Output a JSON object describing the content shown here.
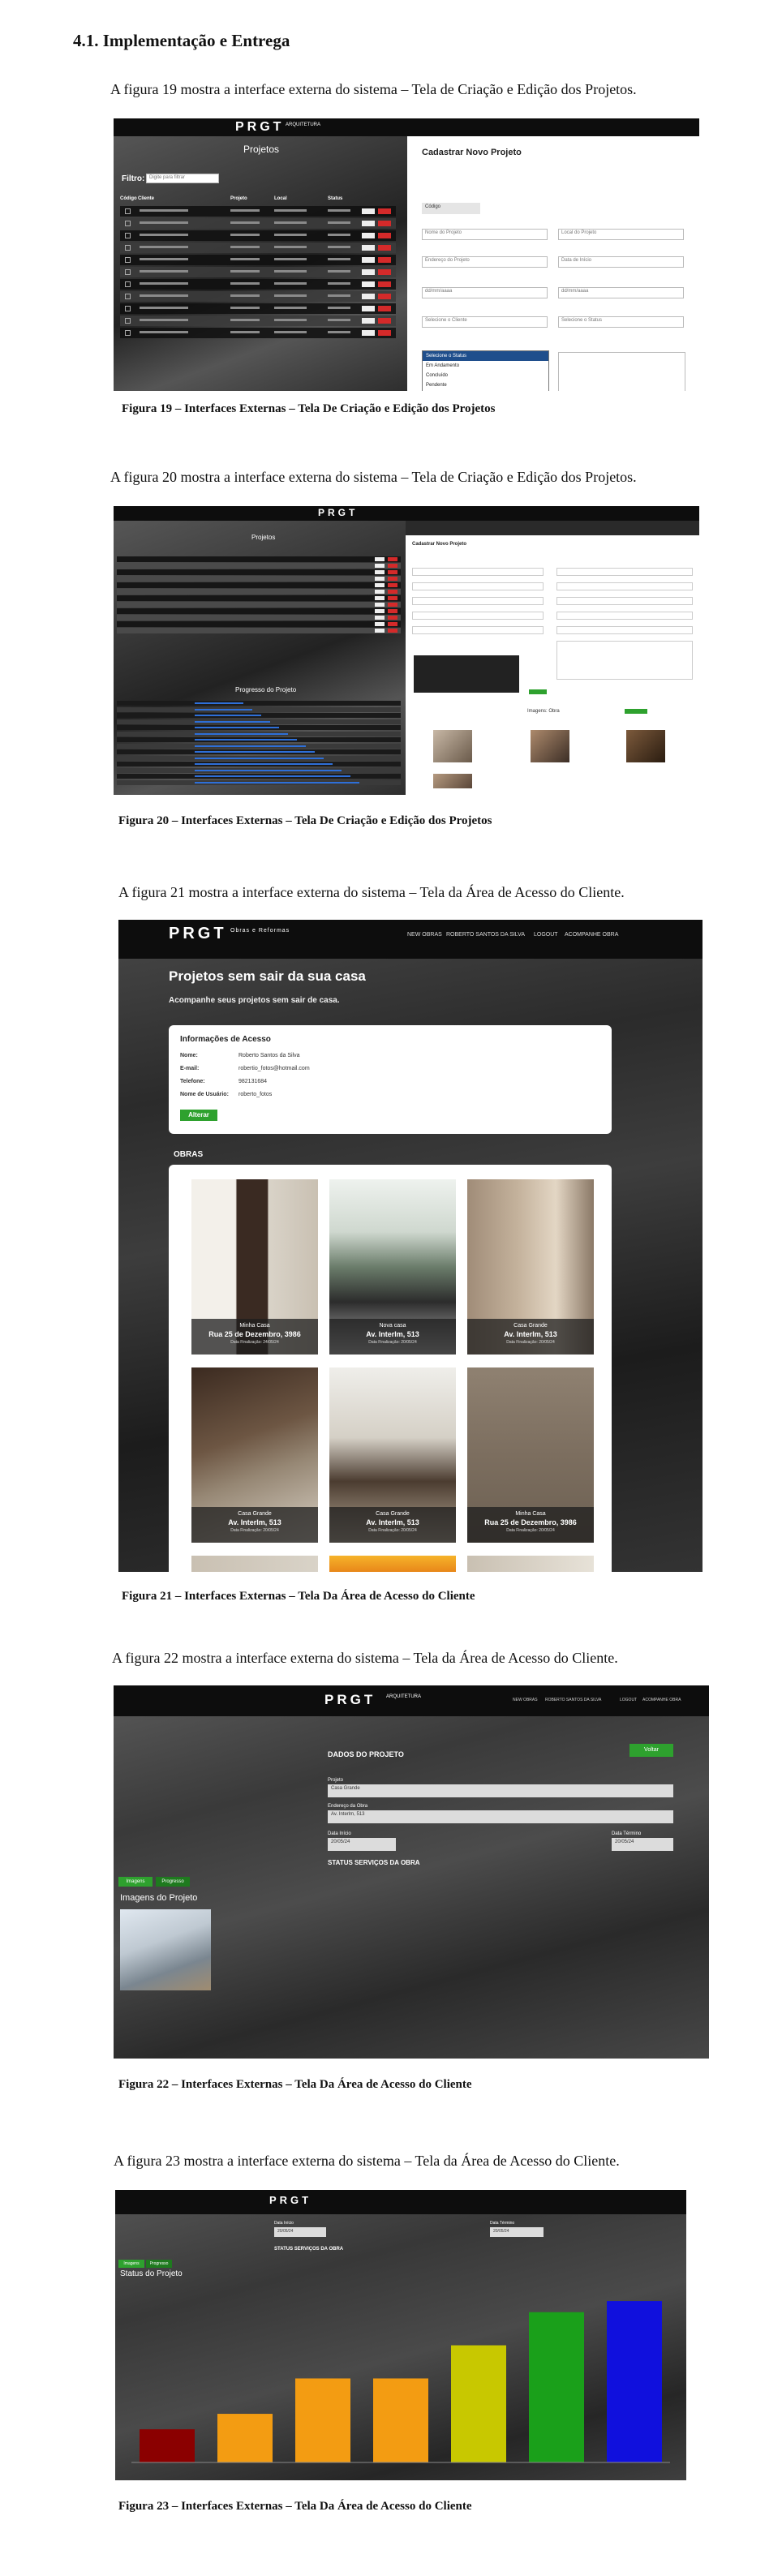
{
  "section_heading": "4.1.  Implementação e Entrega",
  "fig19": {
    "intro": "A figura 19 mostra a interface externa do sistema – Tela de Criação e Edição dos Projetos.",
    "caption": "Figura 19 – Interfaces Externas – Tela De Criação e Edição dos Projetos",
    "logo": "PRGT",
    "logo_sub": "ARQUITETURA",
    "list_title": "Projetos",
    "filter_label": "Filtro:",
    "filter_placeholder": "Digite para filtrar",
    "columns": [
      "Código",
      "Cliente",
      "Projeto",
      "Local",
      "Status"
    ],
    "form_title": "Cadastrar Novo Projeto",
    "fields": [
      "Código",
      "Nome do Projeto",
      "Local do Projeto",
      "Endereço do Projeto",
      "Data de Início",
      "dd/mm/aaaa",
      "dd/mm/aaaa",
      "Selecione o Cliente",
      "Selecione o Status"
    ],
    "dropdown": [
      "Selecione o Status",
      "Em Andamento",
      "Concluído",
      "Pendente"
    ]
  },
  "fig20": {
    "intro": "A figura 20 mostra a interface externa do sistema – Tela de Criação e Edição dos Projetos.",
    "caption": "Figura 20 – Interfaces Externas – Tela De Criação e Edição dos Projetos",
    "list_title": "Projetos",
    "form_title": "Cadastrar Novo Projeto",
    "progress_title": "Progresso do Projeto",
    "images_title": "Imagens",
    "images_label": "Imagens: Obra"
  },
  "fig21": {
    "intro": "A figura 21 mostra a interface externa do sistema – Tela da Área de Acesso do Cliente.",
    "caption": "Figura 21 – Interfaces Externas – Tela Da Área de Acesso do Cliente",
    "logo": "PRGT",
    "logo_sub": "Obras e Reformas",
    "nav": [
      "NEW OBRAS",
      "ROBERTO SANTOS DA SILVA",
      "LOGOUT",
      "ACOMPANHE OBRA"
    ],
    "hero_title": "Projetos sem sair da sua casa",
    "hero_sub": "Acompanhe seus projetos sem sair de casa.",
    "access_title": "Informações de Acesso",
    "access_rows": [
      {
        "k": "Nome:",
        "v": "Roberto Santos da Silva"
      },
      {
        "k": "E-mail:",
        "v": "robertio_fotos@hotmail.com"
      },
      {
        "k": "Telefone:",
        "v": "982131684"
      },
      {
        "k": "Nome de Usuário:",
        "v": "roberto_fotos"
      }
    ],
    "access_button": "Alterar",
    "obras_title": "OBRAS",
    "cards": [
      {
        "title": "Minha Casa",
        "addr": "Rua 25 de Dezembro, 3986",
        "date": "Data Finalização: 24/05/24"
      },
      {
        "title": "Nova casa",
        "addr": "Av. Interlm, 513",
        "date": "Data Finalização: 20/05/24"
      },
      {
        "title": "Casa Grande",
        "addr": "Av. Interlm, 513",
        "date": "Data Finalização: 20/05/24"
      },
      {
        "title": "Casa Grande",
        "addr": "Av. Interlm, 513",
        "date": "Data Finalização: 20/05/24"
      },
      {
        "title": "Casa Grande",
        "addr": "Av. Interlm, 513",
        "date": "Data Finalização: 20/05/24"
      },
      {
        "title": "Minha Casa",
        "addr": "Rua 25 de Dezembro, 3986",
        "date": "Data Finalização: 20/05/24"
      }
    ]
  },
  "fig22": {
    "intro": "A figura 22 mostra a interface externa do sistema – Tela da Área de Acesso do Cliente.",
    "caption": "Figura 22 – Interfaces Externas – Tela Da Área de Acesso do Cliente",
    "logo": "PRGT",
    "logo_sub": "ARQUITETURA",
    "nav": [
      "NEW OBRAS",
      "ROBERTO SANTOS DA SILVA",
      "LOGOUT",
      "ACOMPANHE OBRA"
    ],
    "section": "DADOS DO PROJETO",
    "back_button": "Voltar",
    "project_label": "Projeto",
    "project_value": "Casa Grande",
    "address_label": "Endereço da Obra",
    "address_value": "Av. Interlm, 513",
    "start_label": "Data Início",
    "start_value": "20/05/24",
    "end_label": "Data Término",
    "end_value": "20/05/24",
    "status_section": "STATUS SERVIÇOS DA OBRA",
    "tabs": [
      "Imagens",
      "Progresso"
    ],
    "images_title": "Imagens do Projeto"
  },
  "fig23": {
    "intro": "A figura 23 mostra a interface externa do sistema – Tela da Área de Acesso do Cliente.",
    "caption": "Figura 23 – Interfaces Externas – Tela Da Área de Acesso do Cliente",
    "logo": "PRGT",
    "start_label": "Data Início",
    "start_value": "20/05/24",
    "end_label": "Data Término",
    "end_value": "20/05/24",
    "status_section": "STATUS SERVIÇOS DA OBRA",
    "tabs": [
      "Imagens",
      "Progresso"
    ],
    "chart_title": "Status do Projeto"
  },
  "chart_data": {
    "type": "bar",
    "title": "Status do Projeto",
    "values": [
      15,
      22,
      38,
      38,
      53,
      68,
      73
    ],
    "colors": [
      "#8b0000",
      "#f39c12",
      "#f39c12",
      "#f39c12",
      "#c8c800",
      "#1aa01a",
      "#1010dd"
    ],
    "ylim": [
      0,
      80
    ]
  }
}
